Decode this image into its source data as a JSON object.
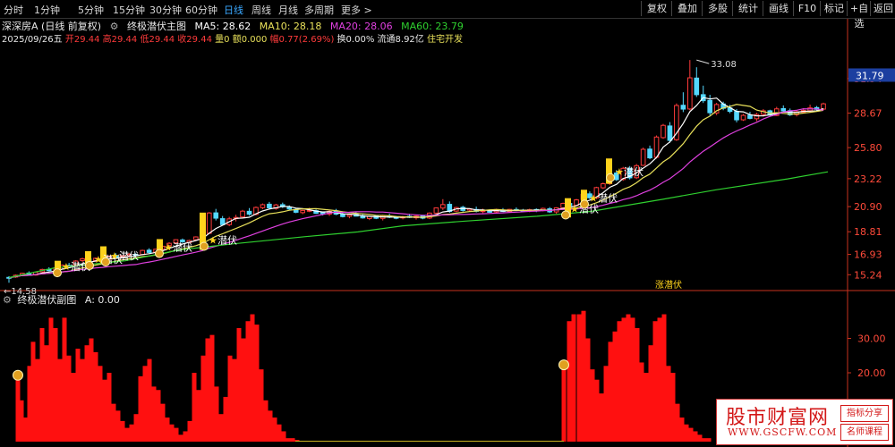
{
  "toolbar": {
    "periods": [
      "分时",
      "1分钟",
      "5分钟",
      "15分钟",
      "30分钟",
      "60分钟",
      "日线",
      "周线",
      "月线",
      "多周期",
      "更多 >"
    ],
    "active_period": "日线",
    "tools": [
      "复权",
      "叠加",
      "多股",
      "统计",
      "画线",
      "F10",
      "标记",
      "+自选",
      "返回"
    ]
  },
  "header": {
    "stock": "深深房A (日线 前复权)",
    "indicator_name": "终极潜伏主图",
    "ma5_label": "MA5: 28.62",
    "ma10_label": "MA10: 28.18",
    "ma20_label": "MA20: 28.06",
    "ma60_label": "MA60: 23.79",
    "date": "2025/09/26五",
    "open": "开29.44",
    "high": "高29.44",
    "low": "低29.44",
    "close": "收29.44",
    "volume": "量0",
    "amount": "额0.000",
    "change": "幅0.77(2.69%)",
    "turnover": "换0.00%",
    "float_shares": "流通8.92亿",
    "sector": "住宅开发"
  },
  "colors": {
    "up": "#ff3b3b",
    "down": "#54d8ff",
    "ma5": "#ffffff",
    "ma10": "#e8e05a",
    "ma20": "#e040e0",
    "ma60": "#2fd02f",
    "signal": "#ffd21c",
    "axis": "#c8321e",
    "price_tag": "#1c3fa0"
  },
  "main_axis": {
    "ticks": [
      "31.54",
      "28.67",
      "25.80",
      "23.22",
      "20.90",
      "18.81",
      "16.93",
      "15.24"
    ],
    "current_price_tag": "31.79",
    "high_annotation": "33.08",
    "low_annotation": "14.58"
  },
  "signals": {
    "label": "潜伏",
    "bottom_marker_label": "涨潜伏"
  },
  "sub_panel": {
    "title": "终极潜伏副图",
    "value_label": "A: 0.00",
    "ticks": [
      "30.00",
      "20.00",
      "10.00"
    ]
  },
  "watermark": {
    "main": "股市财富网",
    "url": "WWW.GSCFW.COM",
    "tag1": "指标分享",
    "tag2": "名师课程"
  },
  "chart_data": {
    "type": "candlestick",
    "ylim": [
      14.0,
      34.5
    ],
    "price_ticks": [
      31.54,
      28.67,
      25.8,
      23.22,
      20.9,
      18.81,
      16.93,
      15.24
    ],
    "candles": [
      [
        15.02,
        15.12,
        14.58,
        14.98
      ],
      [
        15.05,
        15.26,
        14.98,
        15.2
      ],
      [
        15.22,
        15.41,
        15.13,
        15.36
      ],
      [
        15.38,
        15.52,
        15.19,
        15.24
      ],
      [
        15.21,
        15.49,
        15.17,
        15.45
      ],
      [
        15.48,
        15.74,
        15.38,
        15.68
      ],
      [
        15.69,
        15.86,
        15.51,
        15.58
      ],
      [
        15.55,
        15.85,
        15.49,
        15.81
      ],
      [
        15.86,
        16.09,
        15.75,
        16.03
      ],
      [
        16.01,
        16.23,
        15.92,
        15.97
      ],
      [
        16.03,
        16.44,
        15.95,
        16.38
      ],
      [
        16.42,
        16.65,
        16.28,
        16.57
      ],
      [
        16.55,
        16.68,
        16.32,
        16.38
      ],
      [
        16.42,
        16.68,
        16.29,
        16.61
      ],
      [
        16.55,
        16.7,
        16.43,
        16.51
      ],
      [
        16.53,
        16.81,
        16.45,
        16.77
      ],
      [
        16.82,
        17.03,
        16.62,
        16.69
      ],
      [
        16.73,
        16.85,
        16.61,
        16.82
      ],
      [
        16.84,
        17.06,
        16.66,
        16.94
      ],
      [
        16.92,
        17.03,
        16.76,
        16.83
      ],
      [
        16.92,
        17.32,
        16.86,
        17.26
      ],
      [
        17.28,
        17.44,
        17.02,
        17.09
      ],
      [
        17.11,
        17.39,
        17.04,
        17.36
      ],
      [
        17.35,
        17.67,
        17.23,
        17.61
      ],
      [
        17.66,
        17.94,
        17.54,
        17.85
      ],
      [
        17.89,
        18.19,
        17.8,
        18.15
      ],
      [
        18.13,
        18.25,
        17.89,
        17.97
      ],
      [
        17.91,
        18.15,
        17.85,
        18.08
      ],
      [
        18.15,
        18.43,
        18.1,
        18.38
      ],
      [
        18.41,
        18.73,
        18.3,
        18.65
      ],
      [
        18.68,
        20.45,
        18.62,
        20.37
      ],
      [
        20.38,
        20.71,
        19.75,
        19.94
      ],
      [
        19.9,
        20.12,
        19.34,
        19.4
      ],
      [
        19.4,
        20.05,
        19.27,
        19.88
      ],
      [
        19.91,
        20.22,
        19.67,
        20.0
      ],
      [
        20.04,
        20.63,
        19.96,
        20.52
      ],
      [
        20.51,
        20.78,
        20.15,
        20.27
      ],
      [
        20.25,
        20.91,
        20.17,
        20.83
      ],
      [
        20.81,
        21.16,
        20.69,
        21.06
      ],
      [
        21.1,
        21.29,
        20.65,
        20.8
      ],
      [
        20.75,
        21.13,
        20.64,
        21.04
      ],
      [
        21.06,
        21.23,
        20.78,
        20.89
      ],
      [
        20.86,
        21.0,
        20.62,
        20.7
      ],
      [
        20.67,
        20.8,
        20.35,
        20.43
      ],
      [
        20.4,
        20.65,
        20.27,
        20.58
      ],
      [
        20.53,
        20.8,
        20.44,
        20.59
      ],
      [
        20.56,
        20.66,
        20.29,
        20.34
      ],
      [
        20.39,
        20.5,
        20.17,
        20.32
      ],
      [
        20.28,
        20.59,
        20.12,
        20.5
      ],
      [
        20.55,
        20.71,
        20.19,
        20.27
      ],
      [
        20.27,
        20.47,
        20.0,
        20.07
      ],
      [
        20.09,
        20.3,
        19.93,
        20.22
      ],
      [
        20.25,
        20.48,
        20.08,
        20.11
      ],
      [
        20.15,
        20.32,
        19.9,
        19.96
      ],
      [
        19.91,
        20.15,
        19.78,
        20.09
      ],
      [
        20.11,
        20.18,
        19.86,
        19.93
      ],
      [
        19.92,
        20.22,
        19.75,
        20.15
      ],
      [
        20.12,
        20.31,
        19.94,
        20.02
      ],
      [
        20.04,
        20.12,
        19.85,
        19.93
      ],
      [
        19.96,
        20.13,
        19.84,
        20.05
      ],
      [
        20.1,
        20.3,
        19.95,
        20.0
      ],
      [
        19.97,
        20.17,
        19.82,
        20.11
      ],
      [
        20.13,
        20.21,
        19.85,
        19.94
      ],
      [
        19.95,
        20.42,
        19.86,
        20.36
      ],
      [
        20.36,
        20.83,
        20.32,
        20.79
      ],
      [
        20.78,
        21.52,
        20.62,
        21.07
      ],
      [
        21.09,
        21.33,
        20.39,
        20.5
      ],
      [
        20.53,
        20.89,
        20.45,
        20.82
      ],
      [
        20.84,
        20.97,
        20.48,
        20.58
      ],
      [
        20.61,
        20.77,
        20.46,
        20.71
      ],
      [
        20.66,
        20.9,
        20.42,
        20.51
      ],
      [
        20.53,
        20.73,
        20.36,
        20.56
      ],
      [
        20.51,
        20.67,
        20.38,
        20.43
      ],
      [
        20.46,
        20.72,
        20.32,
        20.66
      ],
      [
        20.61,
        20.78,
        20.45,
        20.49
      ],
      [
        20.49,
        20.7,
        20.43,
        20.67
      ],
      [
        20.66,
        20.83,
        20.53,
        20.62
      ],
      [
        20.61,
        20.71,
        20.49,
        20.57
      ],
      [
        20.55,
        20.73,
        20.43,
        20.64
      ],
      [
        20.66,
        20.75,
        20.44,
        20.56
      ],
      [
        20.57,
        20.82,
        20.5,
        20.75
      ],
      [
        20.72,
        20.86,
        20.37,
        20.46
      ],
      [
        20.46,
        20.85,
        20.31,
        20.8
      ],
      [
        20.8,
        21.23,
        20.69,
        21.17
      ],
      [
        21.16,
        21.45,
        20.89,
        20.98
      ],
      [
        21.0,
        21.54,
        20.94,
        21.46
      ],
      [
        21.49,
        22.04,
        21.39,
        21.92
      ],
      [
        21.96,
        22.16,
        21.52,
        21.63
      ],
      [
        21.63,
        22.55,
        21.52,
        22.48
      ],
      [
        22.46,
        22.9,
        22.36,
        22.8
      ],
      [
        22.81,
        23.87,
        22.7,
        23.68
      ],
      [
        23.69,
        23.93,
        23.03,
        23.14
      ],
      [
        23.15,
        24.2,
        23.04,
        24.08
      ],
      [
        24.06,
        24.27,
        23.15,
        23.29
      ],
      [
        23.3,
        24.44,
        23.19,
        24.3
      ],
      [
        24.33,
        25.8,
        24.27,
        25.66
      ],
      [
        25.68,
        25.97,
        24.84,
        24.95
      ],
      [
        25.0,
        26.81,
        24.9,
        26.68
      ],
      [
        26.63,
        27.77,
        26.53,
        27.65
      ],
      [
        27.6,
        27.92,
        26.21,
        26.4
      ],
      [
        26.46,
        29.47,
        26.36,
        29.3
      ],
      [
        29.32,
        30.4,
        28.75,
        29.0
      ],
      [
        29.01,
        33.08,
        28.9,
        31.6
      ],
      [
        31.58,
        32.48,
        30.01,
        30.2
      ],
      [
        30.2,
        30.95,
        29.51,
        29.7
      ],
      [
        29.73,
        30.19,
        28.46,
        28.7
      ],
      [
        28.68,
        29.52,
        28.5,
        29.38
      ],
      [
        29.43,
        29.62,
        28.91,
        29.07
      ],
      [
        29.1,
        29.35,
        28.66,
        28.81
      ],
      [
        28.8,
        29.01,
        27.9,
        28.11
      ],
      [
        28.11,
        28.6,
        28.02,
        28.48
      ],
      [
        28.5,
        28.78,
        28.15,
        28.23
      ],
      [
        28.2,
        28.69,
        27.99,
        28.55
      ],
      [
        28.57,
        29.0,
        28.37,
        28.86
      ],
      [
        28.86,
        28.95,
        28.4,
        28.51
      ],
      [
        28.47,
        29.19,
        28.43,
        29.02
      ],
      [
        29.04,
        29.31,
        28.71,
        28.85
      ],
      [
        28.87,
        29.05,
        28.43,
        28.53
      ],
      [
        28.55,
        28.93,
        28.39,
        28.78
      ],
      [
        28.75,
        29.07,
        28.63,
        28.9
      ],
      [
        28.87,
        29.37,
        28.7,
        29.1
      ],
      [
        29.13,
        29.26,
        28.87,
        28.98
      ],
      [
        29.0,
        29.53,
        28.91,
        29.44
      ]
    ],
    "ma60": [
      [
        10,
        15.0
      ],
      [
        60,
        15.8
      ],
      [
        140,
        16.4
      ],
      [
        200,
        17.3
      ],
      [
        260,
        17.8
      ],
      [
        340,
        18.4
      ],
      [
        400,
        18.8
      ],
      [
        450,
        19.3
      ],
      [
        520,
        19.7
      ],
      [
        600,
        20.1
      ],
      [
        660,
        20.5
      ],
      [
        740,
        21.5
      ],
      [
        800,
        22.3
      ],
      [
        880,
        23.2
      ],
      [
        925,
        23.79
      ]
    ],
    "signal_bars": [
      [
        64,
        15.2,
        16.4
      ],
      [
        98,
        15.9,
        17.2
      ],
      [
        115,
        16.2,
        17.6
      ],
      [
        178,
        16.8,
        18.2
      ],
      [
        226,
        17.3,
        20.4
      ],
      [
        634,
        20.0,
        21.6
      ],
      [
        652,
        21.1,
        22.3
      ],
      [
        680,
        22.8,
        24.9
      ]
    ],
    "signal_labels": [
      [
        66,
        15.7
      ],
      [
        102,
        16.3
      ],
      [
        120,
        16.6
      ],
      [
        180,
        17.3
      ],
      [
        230,
        17.9
      ],
      [
        634,
        20.5
      ],
      [
        655,
        21.4
      ],
      [
        684,
        23.6
      ]
    ],
    "sub_values": [
      [
        20,
        18
      ],
      [
        24,
        12
      ],
      [
        28,
        7
      ],
      [
        33,
        22
      ],
      [
        37,
        29
      ],
      [
        42,
        24
      ],
      [
        47,
        33
      ],
      [
        52,
        28
      ],
      [
        57,
        36
      ],
      [
        62,
        33
      ],
      [
        67,
        24
      ],
      [
        72,
        36
      ],
      [
        77,
        25
      ],
      [
        82,
        20
      ],
      [
        87,
        27
      ],
      [
        92,
        24
      ],
      [
        97,
        28
      ],
      [
        102,
        30
      ],
      [
        107,
        26
      ],
      [
        112,
        22
      ],
      [
        117,
        18
      ],
      [
        122,
        20
      ],
      [
        127,
        11
      ],
      [
        132,
        9
      ],
      [
        137,
        6
      ],
      [
        142,
        4
      ],
      [
        147,
        5
      ],
      [
        152,
        8
      ],
      [
        157,
        19
      ],
      [
        162,
        22
      ],
      [
        167,
        24
      ],
      [
        172,
        16
      ],
      [
        177,
        15
      ],
      [
        182,
        11
      ],
      [
        187,
        7
      ],
      [
        192,
        5
      ],
      [
        197,
        4
      ],
      [
        202,
        2
      ],
      [
        207,
        3
      ],
      [
        212,
        6
      ],
      [
        217,
        20
      ],
      [
        222,
        15
      ],
      [
        227,
        25
      ],
      [
        232,
        30
      ],
      [
        237,
        31
      ],
      [
        242,
        16
      ],
      [
        247,
        8
      ],
      [
        252,
        13
      ],
      [
        257,
        25
      ],
      [
        262,
        24
      ],
      [
        267,
        33
      ],
      [
        272,
        30
      ],
      [
        277,
        35
      ],
      [
        282,
        37
      ],
      [
        287,
        34
      ],
      [
        292,
        21
      ],
      [
        297,
        12
      ],
      [
        302,
        9
      ],
      [
        307,
        7
      ],
      [
        312,
        5
      ],
      [
        317,
        3
      ],
      [
        322,
        1
      ],
      [
        327,
        1
      ],
      [
        332,
        0.5
      ],
      [
        630,
        21
      ],
      [
        636,
        35
      ],
      [
        641,
        37
      ],
      [
        647,
        37
      ],
      [
        652,
        38
      ],
      [
        657,
        30
      ],
      [
        662,
        21
      ],
      [
        667,
        18
      ],
      [
        672,
        14
      ],
      [
        677,
        22
      ],
      [
        682,
        29
      ],
      [
        687,
        32
      ],
      [
        692,
        35
      ],
      [
        697,
        36
      ],
      [
        702,
        37
      ],
      [
        707,
        36
      ],
      [
        712,
        33
      ],
      [
        717,
        23
      ],
      [
        722,
        20
      ],
      [
        727,
        28
      ],
      [
        732,
        35
      ],
      [
        737,
        36
      ],
      [
        742,
        37
      ],
      [
        747,
        22
      ],
      [
        752,
        20
      ],
      [
        757,
        11
      ],
      [
        762,
        7
      ],
      [
        767,
        5
      ],
      [
        772,
        4
      ],
      [
        777,
        3
      ],
      [
        782,
        2
      ],
      [
        787,
        1
      ],
      [
        792,
        1
      ]
    ],
    "sub_ylim": [
      0,
      40
    ]
  }
}
